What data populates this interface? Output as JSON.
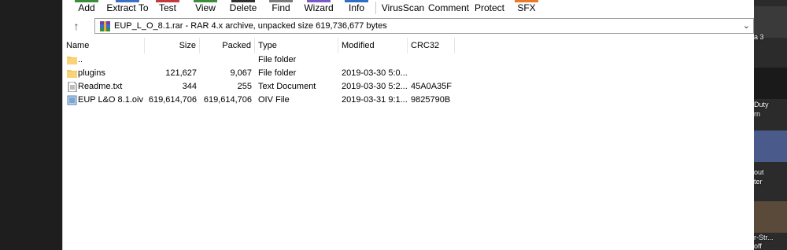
{
  "toolbar": {
    "buttons": [
      {
        "label": "Add",
        "color": "#3a8d3a"
      },
      {
        "label": "Extract To",
        "color": "#3a6fc4"
      },
      {
        "label": "Test",
        "color": "#c43a3a"
      },
      {
        "label": "View",
        "color": "#3a8d3a"
      },
      {
        "label": "Delete",
        "color": "#2f2f2f"
      },
      {
        "label": "Find",
        "color": "#7a7a7a"
      },
      {
        "label": "Wizard",
        "color": "#7a5ac4"
      },
      {
        "label": "Info",
        "color": "#2f6fc4"
      },
      {
        "label": "VirusScan",
        "color": "#ffffff"
      },
      {
        "label": "Comment",
        "color": "#ffffff"
      },
      {
        "label": "Protect",
        "color": "#ffffff"
      },
      {
        "label": "SFX",
        "color": "#e87a2a"
      }
    ]
  },
  "address": {
    "up_icon": "up-arrow-icon",
    "path": "EUP_L_O_8.1.rar - RAR 4.x archive, unpacked size 619,736,677 bytes",
    "dropdown_icon": "chevron-down-icon"
  },
  "columns": {
    "name": "Name",
    "size": "Size",
    "packed": "Packed",
    "type": "Type",
    "modified": "Modified",
    "crc": "CRC32"
  },
  "files": [
    {
      "name": "..",
      "size": "",
      "packed": "",
      "type": "File folder",
      "modified": "",
      "crc": "",
      "icon": "folder-icon"
    },
    {
      "name": "plugins",
      "size": "121,627",
      "packed": "9,067",
      "type": "File folder",
      "modified": "2019-03-30 5:0...",
      "crc": "",
      "icon": "folder-icon"
    },
    {
      "name": "Readme.txt",
      "size": "344",
      "packed": "255",
      "type": "Text Document",
      "modified": "2019-03-30 5:2...",
      "crc": "45A0A35F",
      "icon": "text-file-icon"
    },
    {
      "name": "EUP L&O 8.1.oiv",
      "size": "619,614,706",
      "packed": "619,614,706",
      "type": "OIV File",
      "modified": "2019-03-31 9:1...",
      "crc": "9825790B",
      "icon": "oiv-file-icon"
    }
  ],
  "desktop": {
    "labels": [
      "a 3",
      "Duty",
      "rn",
      "out",
      "ter",
      "r-Str...",
      "off"
    ]
  },
  "colors": {
    "folder": "#f5c65a",
    "accent_border": "#a0a0a0"
  }
}
